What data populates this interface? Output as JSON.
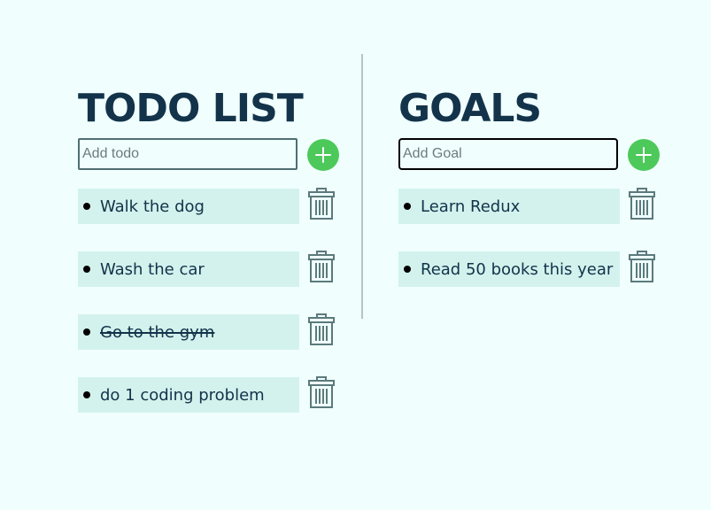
{
  "todos": {
    "title": "TODO LIST",
    "input_placeholder": "Add todo",
    "input_value": "",
    "add_icon": "plus-icon",
    "delete_icon": "trash-icon",
    "items": [
      {
        "label": "Walk the dog",
        "completed": false
      },
      {
        "label": "Wash the car",
        "completed": false
      },
      {
        "label": "Go to the gym",
        "completed": true
      },
      {
        "label": "do 1 coding problem",
        "completed": false
      }
    ]
  },
  "goals": {
    "title": "GOALS",
    "input_placeholder": "Add Goal",
    "input_value": "",
    "input_focused": true,
    "add_icon": "plus-icon",
    "delete_icon": "trash-icon",
    "items": [
      {
        "label": "Learn Redux"
      },
      {
        "label": "Read 50 books this year"
      }
    ]
  },
  "colors": {
    "background": "#f0fffe",
    "heading": "#12334a",
    "item_background": "#d3f2ed",
    "add_button": "#4cc95a",
    "trash_icon": "#5b7a7c",
    "divider": "#b7c4c6"
  }
}
